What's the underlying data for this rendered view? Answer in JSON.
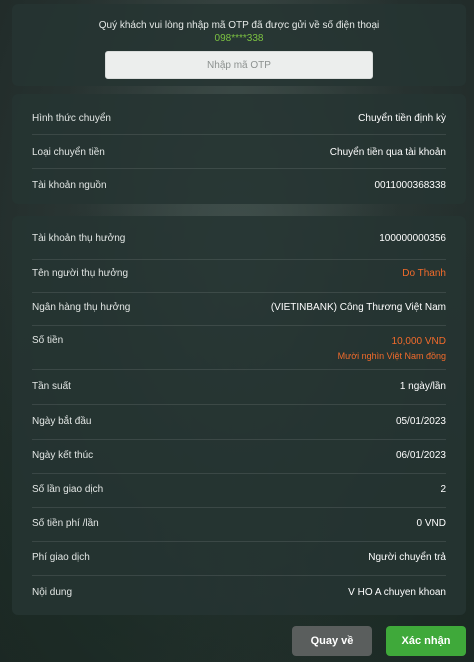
{
  "otp": {
    "message": "Quý khách vui lòng nhập mã OTP đã được gửi về số điện thoại",
    "phone": "098****338",
    "placeholder": "Nhập mã OTP"
  },
  "section1": [
    {
      "label": "Hình thức chuyển",
      "value": "Chuyển tiền định kỳ"
    },
    {
      "label": "Loại chuyển tiền",
      "value": "Chuyển tiền qua tài khoản"
    },
    {
      "label": "Tài khoản nguồn",
      "value": "0011000368338"
    }
  ],
  "section2": {
    "beneficiary_account": {
      "label": "Tài khoản thụ hưởng",
      "value": "100000000356"
    },
    "beneficiary_name": {
      "label": "Tên người thụ hưởng",
      "value": "Do Thanh"
    },
    "beneficiary_bank": {
      "label": "Ngân hàng thụ hưởng",
      "value": "(VIETINBANK) Công Thương Việt Nam"
    },
    "amount": {
      "label": "Số tiền",
      "value": "10,000 VND",
      "in_words": "Mười nghìn Việt Nam đồng"
    },
    "frequency": {
      "label": "Tần suất",
      "value": "1 ngày/lần"
    },
    "start_date": {
      "label": "Ngày bắt đầu",
      "value": "05/01/2023"
    },
    "end_date": {
      "label": "Ngày kết thúc",
      "value": "06/01/2023"
    },
    "count": {
      "label": "Số lần giao dịch",
      "value": "2"
    },
    "fee_per_time": {
      "label": "Số tiền phí /lần",
      "value": "0 VND"
    },
    "fee_payer": {
      "label": "Phí giao dịch",
      "value": "Người chuyển trả"
    },
    "content": {
      "label": "Nội dung",
      "value": "V HO A chuyen khoan"
    }
  },
  "buttons": {
    "back": "Quay về",
    "confirm": "Xác nhận"
  },
  "colors": {
    "accent_green": "#3fa93a",
    "phone_green": "#7cc242",
    "highlight_orange": "#f26b2b"
  }
}
